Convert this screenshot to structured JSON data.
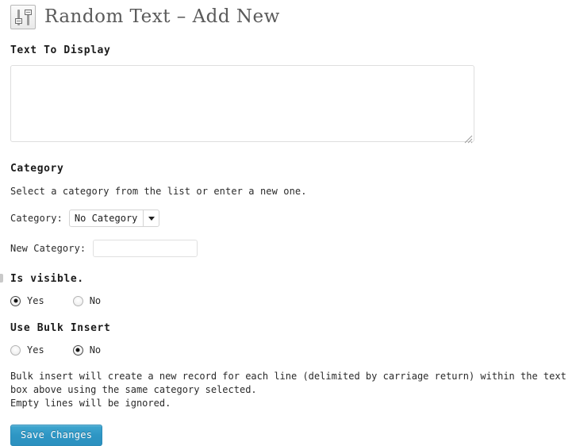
{
  "header": {
    "icon": "sliders-icon",
    "title": "Random Text – Add New"
  },
  "form": {
    "text_to_display": {
      "heading": "Text To Display",
      "value": "",
      "placeholder": ""
    },
    "category": {
      "heading": "Category",
      "helper": "Select a category from the list or enter a new one.",
      "select_label": "Category:",
      "selected_option": "No Category",
      "options": [
        "No Category"
      ],
      "new_category_label": "New Category:",
      "new_category_value": "",
      "new_category_placeholder": ""
    },
    "is_visible": {
      "heading": "Is visible.",
      "options": [
        {
          "label": "Yes",
          "checked": true
        },
        {
          "label": "No",
          "checked": false
        }
      ]
    },
    "bulk_insert": {
      "heading": "Use Bulk Insert",
      "options": [
        {
          "label": "Yes",
          "checked": false
        },
        {
          "label": "No",
          "checked": true
        }
      ],
      "note_line_1": "Bulk insert will create a new record for each line (delimited by carriage return) within the text box above using the same category selected.",
      "note_line_2": "Empty lines will be ignored."
    },
    "save_label": "Save Changes"
  },
  "colors": {
    "accent": "#2e96c4",
    "title_text": "#5a5a5a",
    "body_text": "#2a2a2a",
    "border": "#dedede"
  }
}
